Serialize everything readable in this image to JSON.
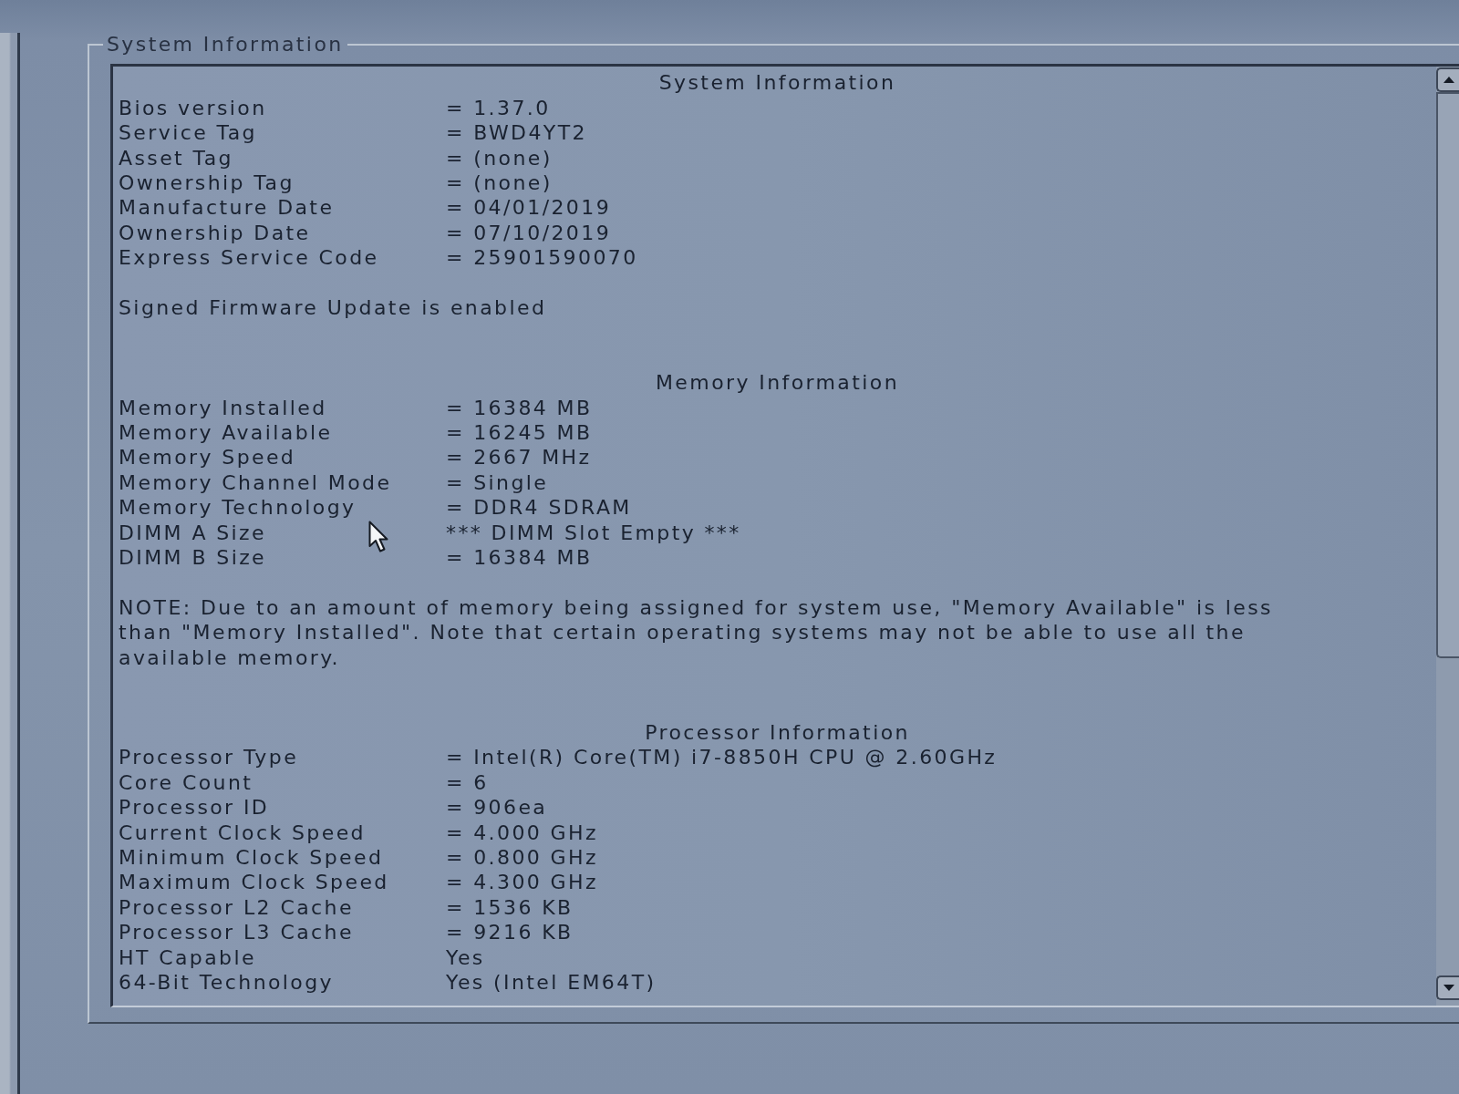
{
  "group_box": {
    "title": "System Information"
  },
  "sections": [
    {
      "heading": "System Information",
      "rows": [
        {
          "label": "Bios version",
          "value": "= 1.37.0"
        },
        {
          "label": "Service Tag",
          "value": "= BWD4YT2"
        },
        {
          "label": "Asset Tag",
          "value": "= (none)"
        },
        {
          "label": "Ownership Tag",
          "value": "= (none)"
        },
        {
          "label": "Manufacture Date",
          "value": "= 04/01/2019"
        },
        {
          "label": "Ownership Date",
          "value": "= 07/10/2019"
        },
        {
          "label": "Express Service Code",
          "value": "= 25901590070"
        }
      ],
      "note": "Signed Firmware Update is enabled"
    },
    {
      "heading": "Memory Information",
      "rows": [
        {
          "label": "Memory Installed",
          "value": "= 16384 MB"
        },
        {
          "label": "Memory Available",
          "value": "= 16245 MB"
        },
        {
          "label": "Memory Speed",
          "value": "= 2667 MHz"
        },
        {
          "label": "Memory Channel Mode",
          "value": "= Single"
        },
        {
          "label": "Memory Technology",
          "value": "= DDR4 SDRAM"
        },
        {
          "label": "DIMM A Size",
          "value": "*** DIMM Slot Empty ***"
        },
        {
          "label": "DIMM B Size",
          "value": "= 16384 MB"
        }
      ],
      "note": "NOTE: Due to an amount of memory being assigned for system use, \"Memory Available\" is less than \"Memory Installed\". Note that certain operating systems may not be able to use all the available memory."
    },
    {
      "heading": "Processor Information",
      "rows": [
        {
          "label": "Processor Type",
          "value": "= Intel(R) Core(TM) i7-8850H CPU @ 2.60GHz"
        },
        {
          "label": "Core Count",
          "value": "= 6"
        },
        {
          "label": "Processor ID",
          "value": "= 906ea"
        },
        {
          "label": "Current Clock Speed",
          "value": "= 4.000 GHz"
        },
        {
          "label": "Minimum Clock Speed",
          "value": "= 0.800 GHz"
        },
        {
          "label": "Maximum Clock Speed",
          "value": "= 4.300 GHz"
        },
        {
          "label": "Processor L2 Cache",
          "value": "= 1536 KB"
        },
        {
          "label": "Processor L3 Cache",
          "value": "= 9216 KB"
        },
        {
          "label": "HT Capable",
          "value": "Yes"
        },
        {
          "label": "64-Bit Technology",
          "value": "Yes (Intel EM64T)"
        }
      ]
    }
  ]
}
